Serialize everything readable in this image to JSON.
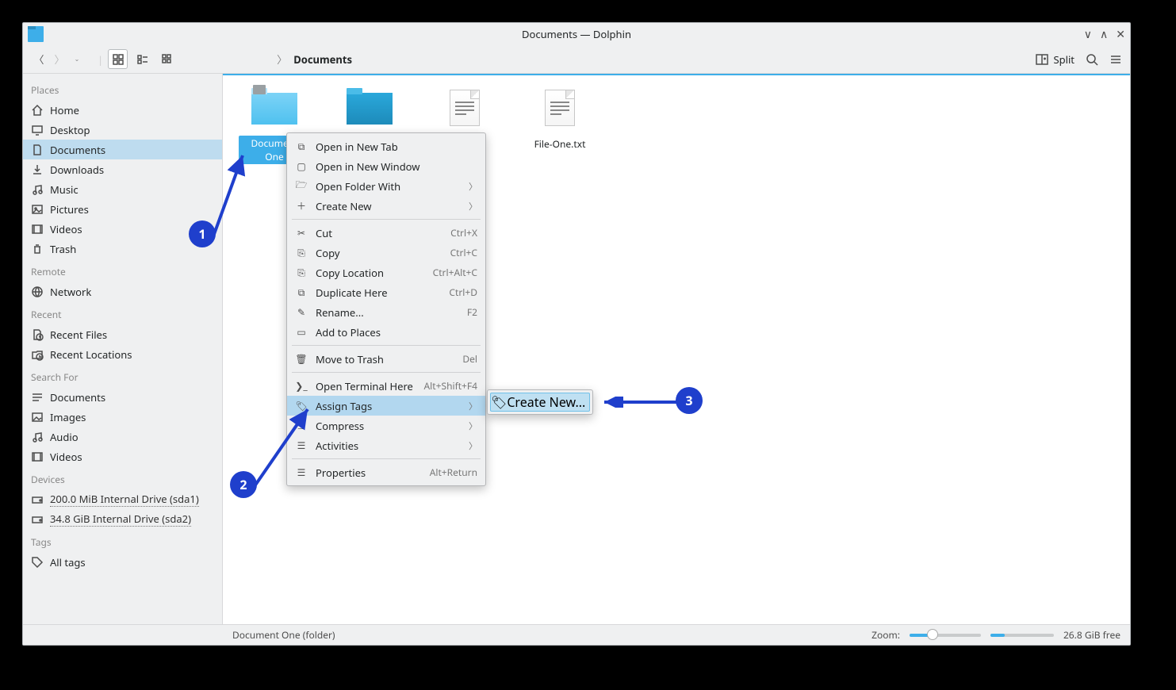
{
  "window": {
    "title": "Documents — Dolphin"
  },
  "toolbar": {
    "split": "Split",
    "breadcrumb": "Documents"
  },
  "sidebar": {
    "places": {
      "label": "Places",
      "items": [
        "Home",
        "Desktop",
        "Documents",
        "Downloads",
        "Music",
        "Pictures",
        "Videos",
        "Trash"
      ]
    },
    "remote": {
      "label": "Remote",
      "items": [
        "Network"
      ]
    },
    "recent": {
      "label": "Recent",
      "items": [
        "Recent Files",
        "Recent Locations"
      ]
    },
    "search": {
      "label": "Search For",
      "items": [
        "Documents",
        "Images",
        "Audio",
        "Videos"
      ]
    },
    "devices": {
      "label": "Devices",
      "items": [
        "200.0 MiB Internal Drive (sda1)",
        "34.8 GiB Internal Drive (sda2)"
      ]
    },
    "tags": {
      "label": "Tags",
      "items": [
        "All tags"
      ]
    }
  },
  "files": {
    "items": [
      {
        "name": "Document One",
        "type": "folder",
        "selected": true
      },
      {
        "name": "",
        "type": "folder"
      },
      {
        "name": "",
        "type": "text"
      },
      {
        "name": "File-One.txt",
        "type": "text"
      }
    ]
  },
  "context_menu": {
    "items": [
      {
        "icon": "tab-new",
        "label": "Open in New Tab"
      },
      {
        "icon": "window-new",
        "label": "Open in New Window"
      },
      {
        "icon": "folder-open",
        "label": "Open Folder With",
        "submenu": true
      },
      {
        "icon": "plus",
        "label": "Create New",
        "submenu": true
      },
      {
        "sep": true
      },
      {
        "icon": "cut",
        "label": "Cut",
        "shortcut": "Ctrl+X"
      },
      {
        "icon": "copy",
        "label": "Copy",
        "shortcut": "Ctrl+C"
      },
      {
        "icon": "copy-loc",
        "label": "Copy Location",
        "shortcut": "Ctrl+Alt+C"
      },
      {
        "icon": "duplicate",
        "label": "Duplicate Here",
        "shortcut": "Ctrl+D"
      },
      {
        "icon": "rename",
        "label": "Rename...",
        "shortcut": "F2"
      },
      {
        "icon": "add-places",
        "label": "Add to Places"
      },
      {
        "sep": true
      },
      {
        "icon": "trash",
        "label": "Move to Trash",
        "shortcut": "Del"
      },
      {
        "sep": true
      },
      {
        "icon": "terminal",
        "label": "Open Terminal Here",
        "shortcut": "Alt+Shift+F4"
      },
      {
        "icon": "tag",
        "label": "Assign Tags",
        "submenu": true,
        "highlighted": true
      },
      {
        "icon": "compress",
        "label": "Compress",
        "submenu": true
      },
      {
        "icon": "activities",
        "label": "Activities",
        "submenu": true
      },
      {
        "sep": true
      },
      {
        "icon": "properties",
        "label": "Properties",
        "shortcut": "Alt+Return"
      }
    ],
    "submenu_tags": {
      "create_new": "Create New..."
    }
  },
  "status": {
    "selection": "Document One (folder)",
    "zoom_label": "Zoom:",
    "disk_free": "26.8 GiB free"
  },
  "annotations": {
    "a1": "1",
    "a2": "2",
    "a3": "3"
  }
}
